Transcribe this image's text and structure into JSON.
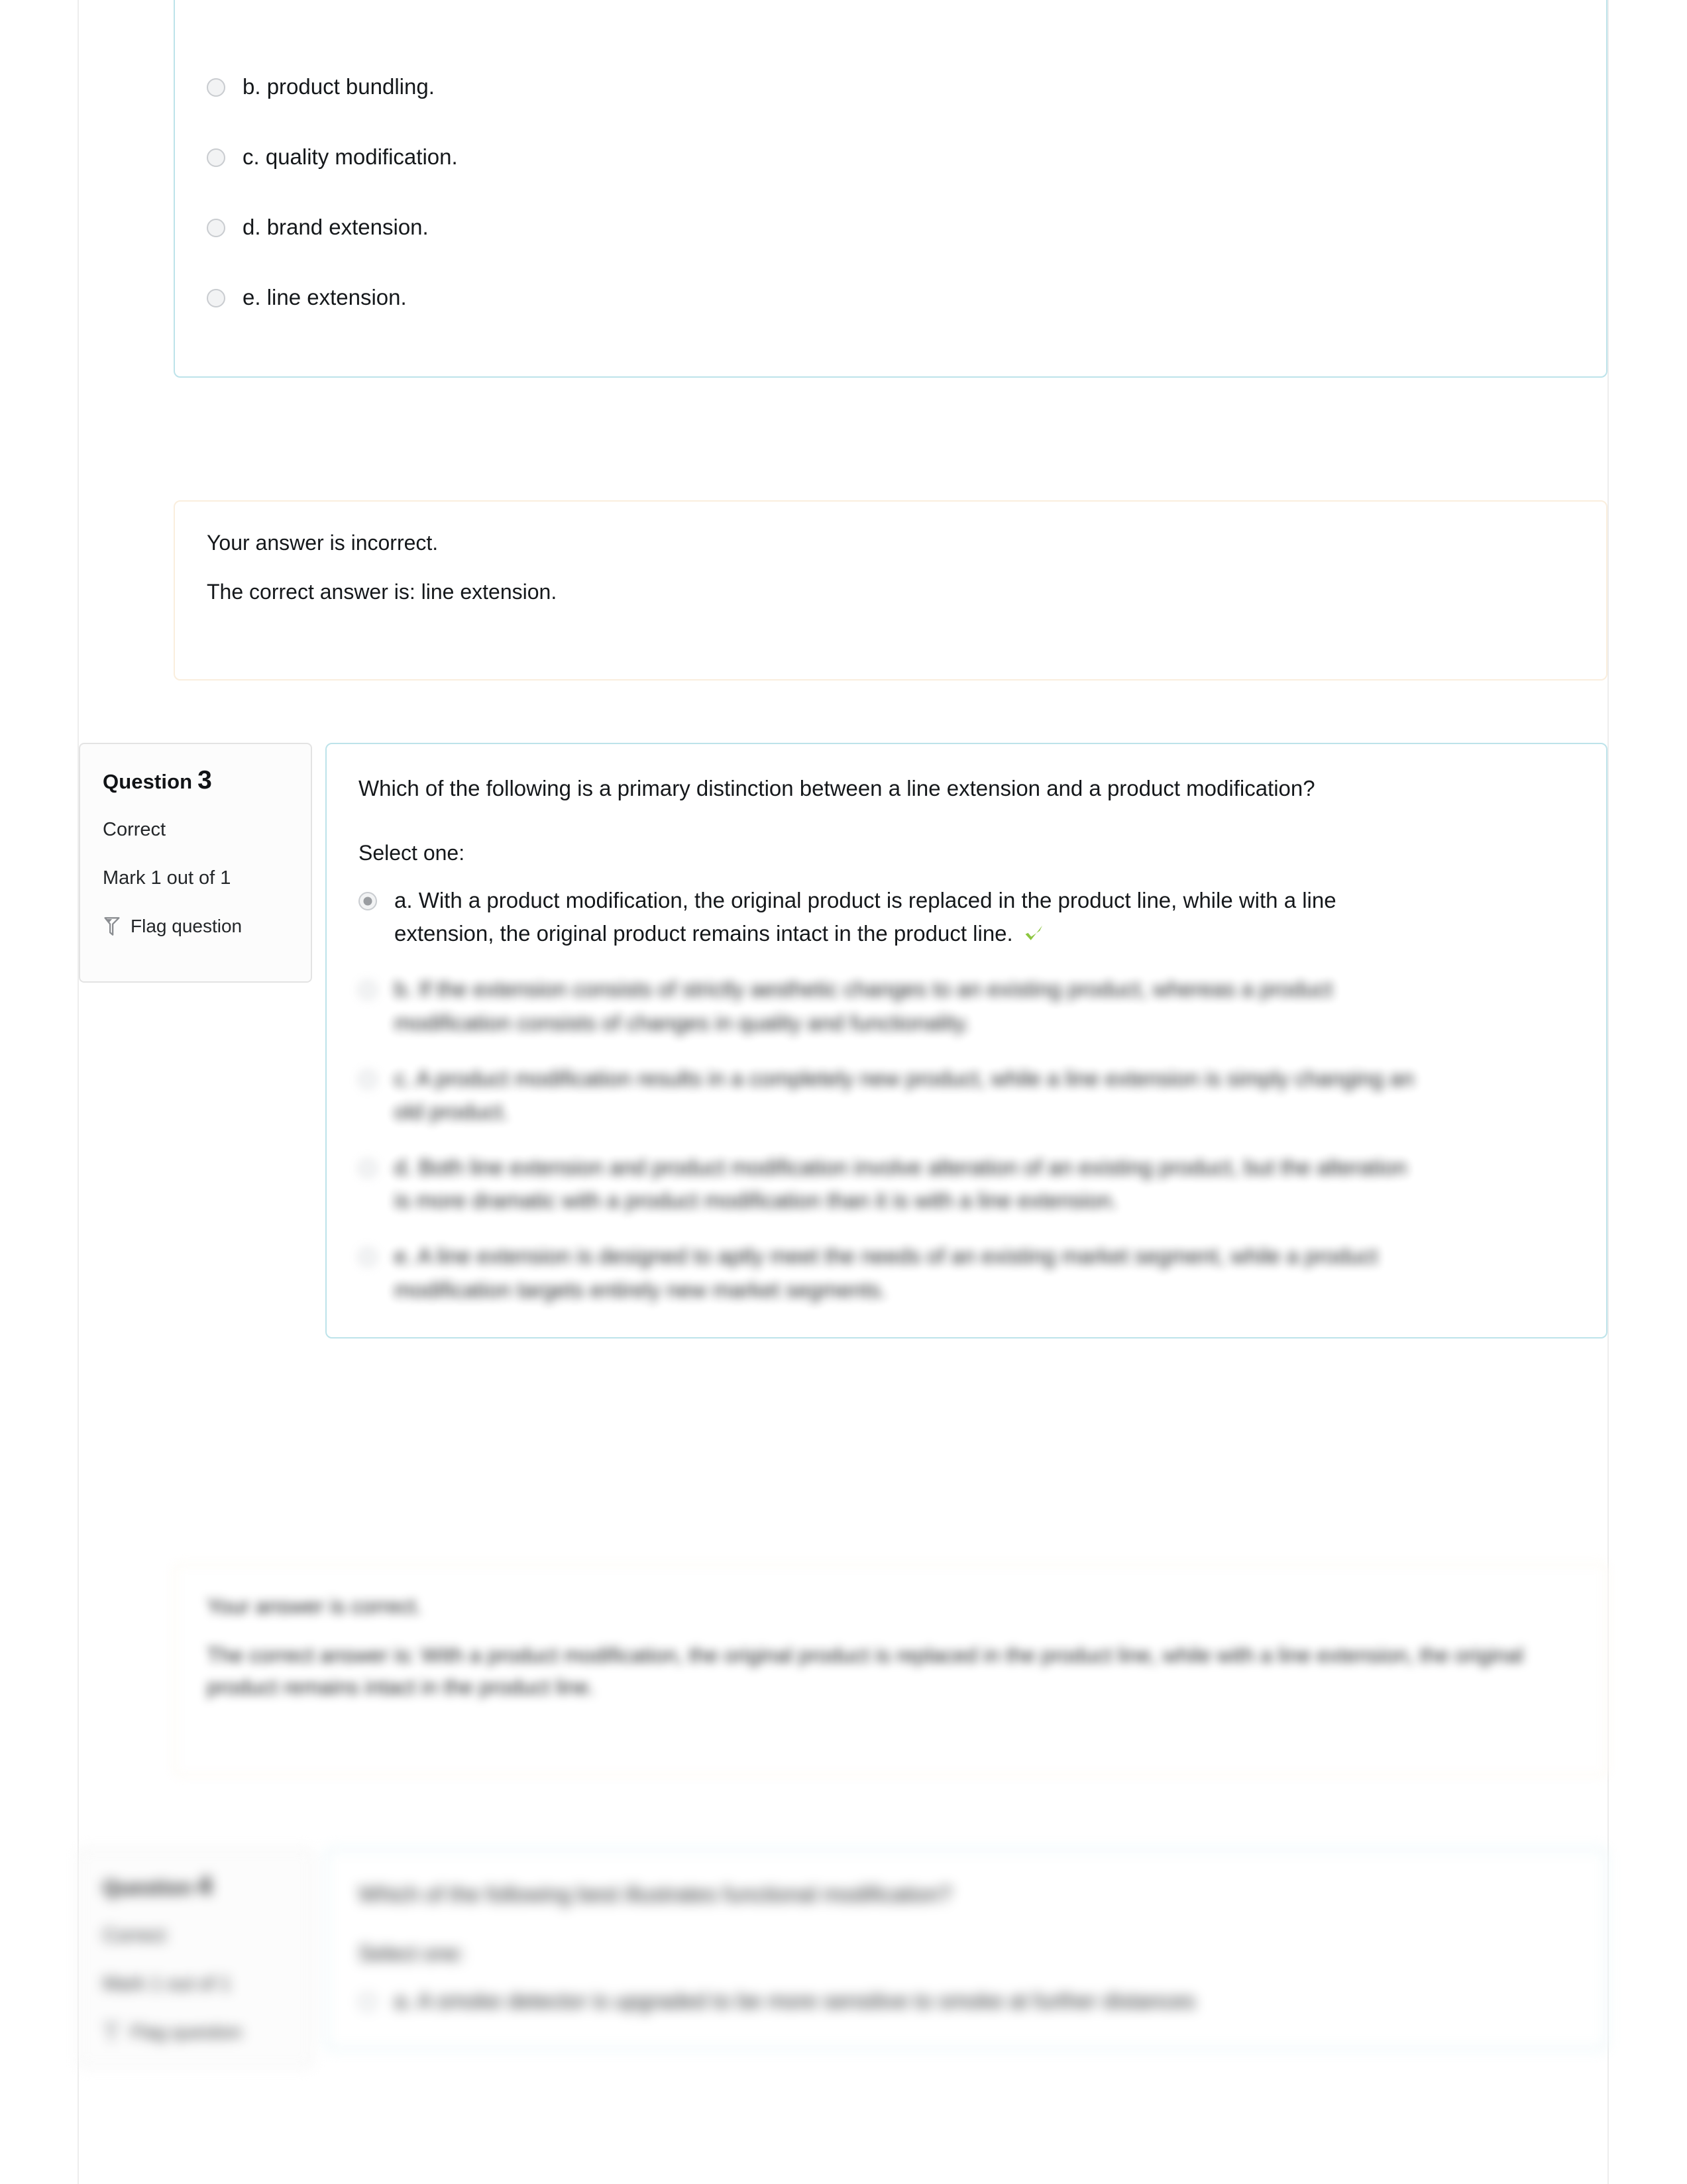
{
  "page": {
    "background": "#ffffff",
    "rail_color": "#ededed",
    "question_border": "#bde3ea",
    "feedback_border": "#faeedd",
    "info_border": "#e3e3e3",
    "correct_tick_color": "#8cc63f",
    "radio_fill": "#9a9da1"
  },
  "question2_tail": {
    "options": [
      {
        "letter_text": "b. product bundling.",
        "checked": false
      },
      {
        "letter_text": "c. quality modification.",
        "checked": false
      },
      {
        "letter_text": "d. brand extension.",
        "checked": false
      },
      {
        "letter_text": "e. line extension.",
        "checked": false
      }
    ],
    "feedback": {
      "result": "Your answer is incorrect.",
      "correct": "The correct answer is: line extension."
    }
  },
  "question3": {
    "info": {
      "label": "Question",
      "number": "3",
      "state": "Correct",
      "mark": "Mark 1 out of 1",
      "flag_label": "Flag question",
      "flag_icon": "flag-icon"
    },
    "text": "Which of the following is a primary distinction between a line extension and a product modification?",
    "select_prompt": "Select one:",
    "options": [
      {
        "letter_text": "a. With a product modification, the original product is replaced in the product line, while with a line extension, the original product remains intact in the product line.",
        "checked": true,
        "correct": true
      },
      {
        "letter_text": "b. If the extension consists of strictly aesthetic changes to an existing product, whereas a product modification consists of changes in quality and functionality.",
        "checked": false,
        "correct": false
      },
      {
        "letter_text": "c. A product modification results in a completely new product, while a line extension is simply changing an old product.",
        "checked": false,
        "correct": false
      },
      {
        "letter_text": "d. Both line extension and product modification involve alteration of an existing product, but the alteration is more dramatic with a product modification than it is with a line extension.",
        "checked": false,
        "correct": false
      },
      {
        "letter_text": "e. A line extension is designed to aptly meet the needs of an existing market segment, while a product modification targets entirely new market segments.",
        "checked": false,
        "correct": false
      }
    ],
    "feedback": {
      "result": "Your answer is correct.",
      "correct": "The correct answer is: With a product modification, the original product is replaced in the product line, while with a line extension, the original product remains intact in the product line."
    }
  },
  "question4": {
    "info": {
      "label": "Question",
      "number": "4",
      "state": "Correct",
      "mark": "Mark 1 out of 1",
      "flag_label": "Flag question",
      "flag_icon": "flag-icon"
    },
    "text": "Which of the following best illustrates functional modification?",
    "select_prompt": "Select one:",
    "options": [
      {
        "letter_text": "a. A smoke detector is upgraded to be more sensitive to smoke at further distances",
        "checked": false,
        "correct": false
      }
    ]
  }
}
